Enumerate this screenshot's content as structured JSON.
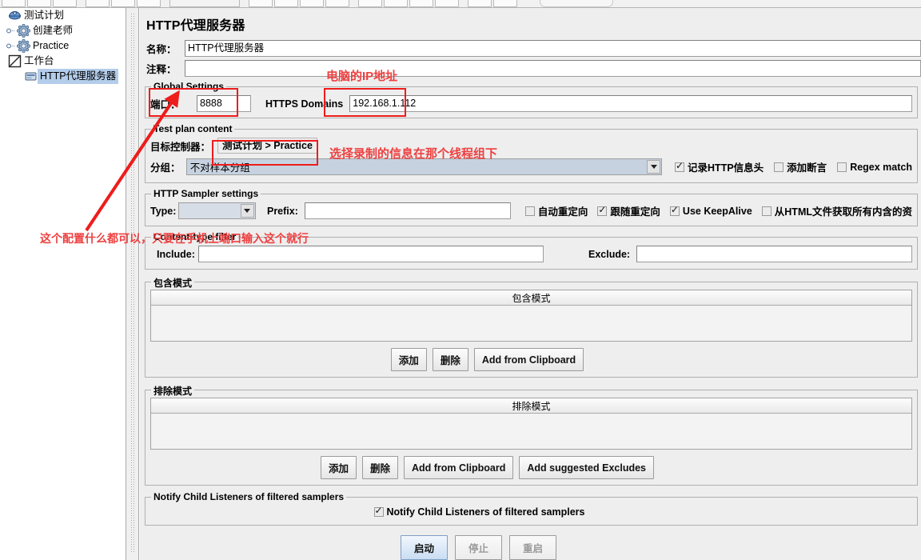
{
  "toolbar": {
    "button_count": 18
  },
  "tree": {
    "items": [
      {
        "label": "测试计划",
        "icon": "test-plan-icon",
        "depth": 0,
        "selected": false,
        "handle": ""
      },
      {
        "label": "创建老师",
        "icon": "thread-group-icon",
        "depth": 1,
        "selected": false,
        "handle": "o-"
      },
      {
        "label": "Practice",
        "icon": "thread-group-icon",
        "depth": 1,
        "selected": false,
        "handle": "o-"
      },
      {
        "label": "工作台",
        "icon": "workbench-icon",
        "depth": 0,
        "selected": false,
        "handle": ""
      },
      {
        "label": "HTTP代理服务器",
        "icon": "http-proxy-icon",
        "depth": 1,
        "selected": true,
        "handle": ""
      }
    ]
  },
  "editor": {
    "title": "HTTP代理服务器",
    "name_label": "名称：",
    "name_value": "HTTP代理服务器",
    "comment_label": "注释：",
    "comment_value": "",
    "global_settings": {
      "title": "Global Settings",
      "port_label": "端口：",
      "port_value": "8888",
      "https_domains_label": "HTTPS Domains",
      "https_domains_value": "192.168.1.112"
    },
    "test_plan_content": {
      "title": "Test plan content",
      "target_controller_label": "目标控制器：",
      "target_controller_value": "测试计划 > Practice",
      "grouping_label": "分组：",
      "grouping_value": "不对样本分组",
      "checkboxes": [
        {
          "label": "记录HTTP信息头",
          "checked": true
        },
        {
          "label": "添加断言",
          "checked": false
        },
        {
          "label": "Regex match",
          "checked": false
        }
      ]
    },
    "sampler_settings": {
      "title": "HTTP Sampler settings",
      "type_label": "Type:",
      "type_value": "",
      "prefix_label": "Prefix:",
      "prefix_value": "",
      "checkboxes": [
        {
          "label": "自动重定向",
          "checked": false
        },
        {
          "label": "跟随重定向",
          "checked": true
        },
        {
          "label": "Use KeepAlive",
          "checked": true
        },
        {
          "label": "从HTML文件获取所有内含的资",
          "checked": false
        }
      ]
    },
    "content_type_filter": {
      "title": "Content-type filter",
      "include_label": "Include:",
      "include_value": "",
      "exclude_label": "Exclude:",
      "exclude_value": ""
    },
    "include_patterns": {
      "title": "包含模式",
      "column_header": "包含模式",
      "rows": [],
      "buttons": [
        "添加",
        "删除",
        "Add from Clipboard"
      ]
    },
    "exclude_patterns": {
      "title": "排除模式",
      "column_header": "排除模式",
      "rows": [],
      "buttons": [
        "添加",
        "删除",
        "Add from Clipboard",
        "Add suggested Excludes"
      ]
    },
    "notify": {
      "title": "Notify Child Listeners of filtered samplers",
      "checkbox_label": "Notify Child Listeners of filtered samplers",
      "checked": true
    },
    "actions": [
      {
        "label": "启动",
        "enabled": true
      },
      {
        "label": "停止",
        "enabled": false
      },
      {
        "label": "重启",
        "enabled": false
      }
    ]
  },
  "annotations": {
    "color": "#ee1c1c",
    "text_color": "#ee4040",
    "ip_note": "电脑的IP地址",
    "target_note": "选择录制的信息在那个线程组下",
    "port_note": "这个配置什么都可以，只要在手机上端口输入这个就行"
  }
}
